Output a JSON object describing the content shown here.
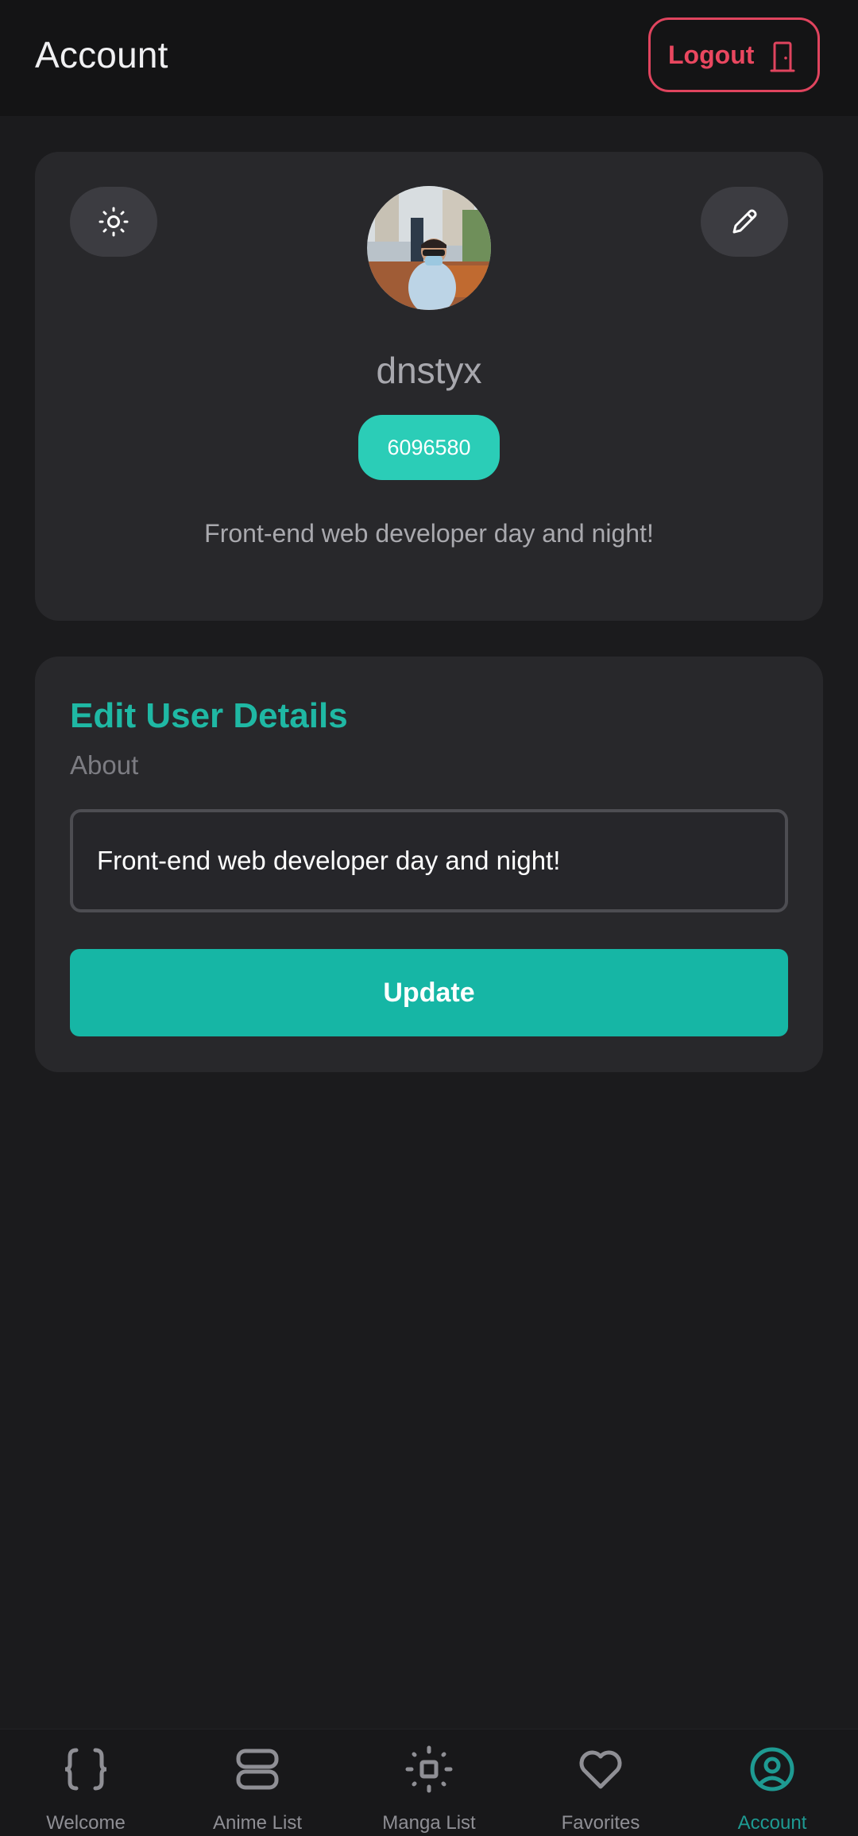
{
  "header": {
    "title": "Account",
    "logout_label": "Logout"
  },
  "profile": {
    "username": "dnstyx",
    "user_id": "6096580",
    "bio": "Front-end web developer day and night!",
    "theme_toggle_icon": "sun-icon",
    "edit_icon": "pencil-icon"
  },
  "edit_details": {
    "title": "Edit User Details",
    "about_label": "About",
    "about_value": "Front-end web developer day and night!",
    "update_label": "Update"
  },
  "nav": {
    "items": [
      {
        "label": "Welcome",
        "icon": "braces-icon",
        "active": false
      },
      {
        "label": "Anime List",
        "icon": "stack-icon",
        "active": false
      },
      {
        "label": "Manga List",
        "icon": "square-focus-icon",
        "active": false
      },
      {
        "label": "Favorites",
        "icon": "heart-icon",
        "active": false
      },
      {
        "label": "Account",
        "icon": "user-circle-icon",
        "active": true
      }
    ]
  },
  "colors": {
    "background": "#1b1b1d",
    "card": "#28282b",
    "accent": "#16b6a5",
    "danger": "#e0445e"
  }
}
